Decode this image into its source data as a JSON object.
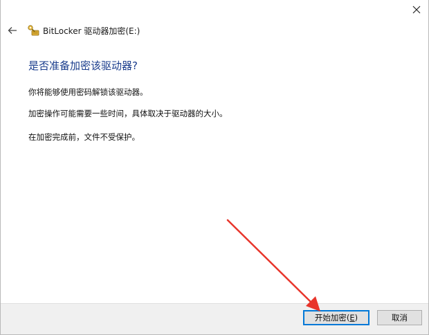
{
  "window": {
    "title": "BitLocker 驱动器加密(E:)",
    "close_icon": "close-icon",
    "back_icon": "back-arrow-icon",
    "app_icon": "bitlocker-key-icon"
  },
  "content": {
    "heading": "是否准备加密该驱动器?",
    "paragraphs": [
      "你将能够使用密码解锁该驱动器。",
      "加密操作可能需要一些时间，具体取决于驱动器的大小。",
      "在加密完成前，文件不受保护。"
    ]
  },
  "footer": {
    "start_button": {
      "label_before": "开始加密(",
      "accel": "E",
      "label_after": ")"
    },
    "cancel_button": {
      "label": "取消"
    }
  },
  "colors": {
    "heading": "#1a3c8c",
    "default_button_border": "#0078d7",
    "annotation_arrow": "#e8352b",
    "footer_bg": "#f0f0f0"
  }
}
